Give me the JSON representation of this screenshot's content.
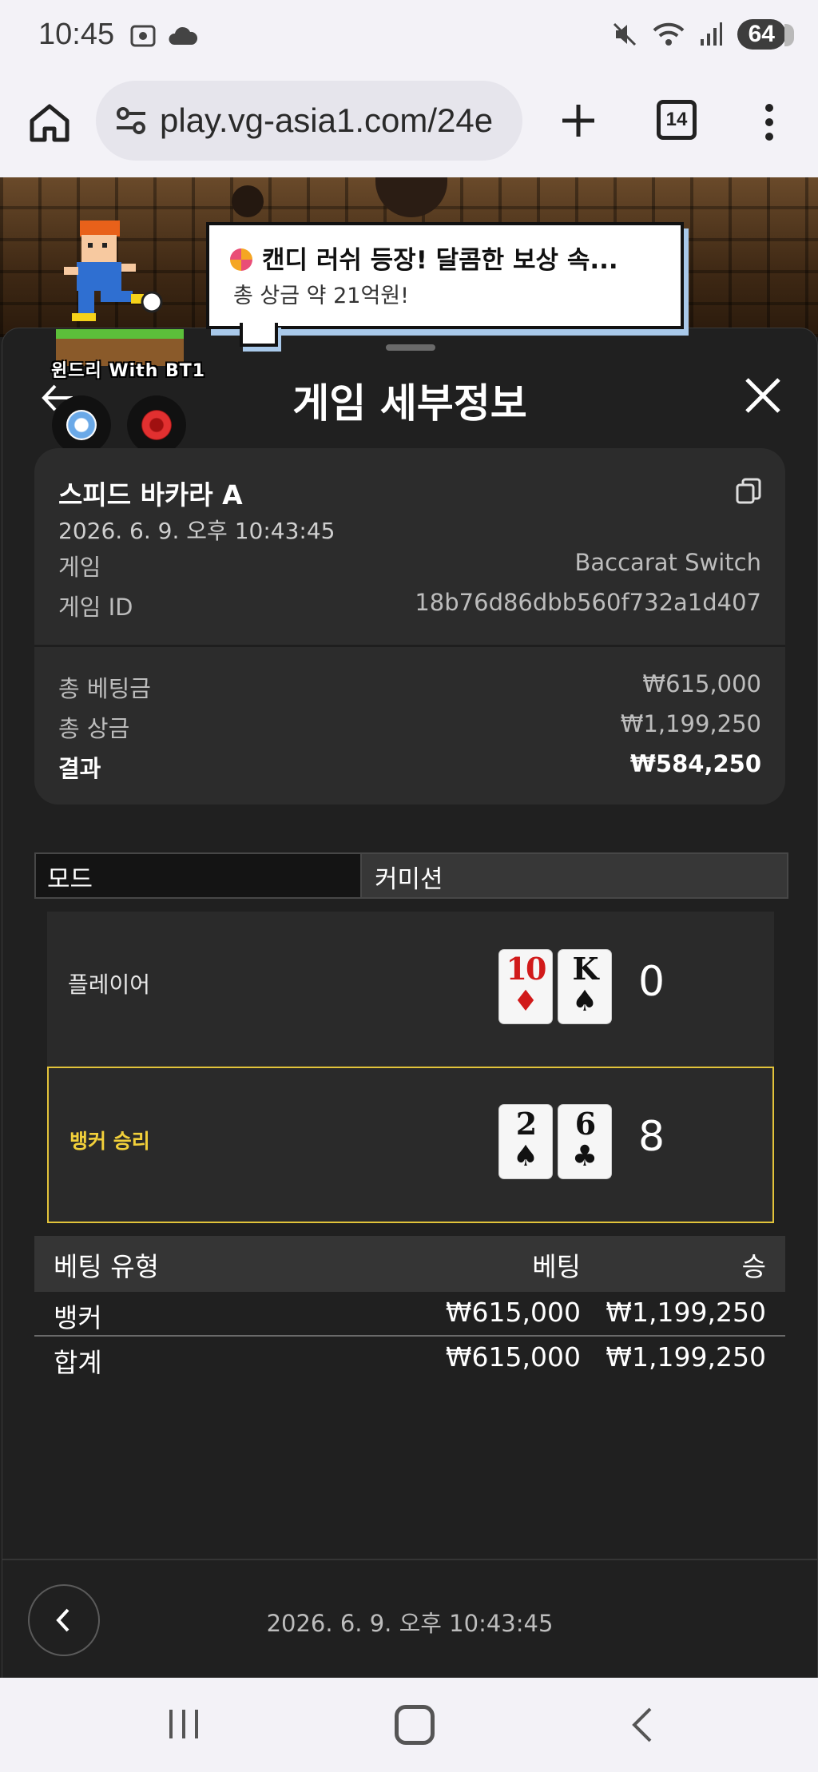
{
  "status_bar": {
    "time": "10:45",
    "battery": "64",
    "icons": [
      "screenshot-icon",
      "cloud-icon",
      "mute-icon",
      "wifi-icon",
      "signal-icon"
    ]
  },
  "browser": {
    "url": "play.vg-asia1.com/24e",
    "tab_count": "14"
  },
  "promo": {
    "title": "캔디 러쉬 등장! 달콤한 보상 속...",
    "subtitle": "총 상금 약 21억원!",
    "mascot_tag": "윈드리 With BT1"
  },
  "sheet": {
    "title": "게임 세부정보"
  },
  "summary": {
    "game_name": "스피드 바카라 A",
    "date": "2026. 6. 9. 오후 10:43:45",
    "rows": [
      {
        "label": "게임",
        "value": "Baccarat Switch"
      },
      {
        "label": "게임 ID",
        "value": "18b76d86dbb560f732a1d407"
      }
    ],
    "totals": [
      {
        "label": "총 베팅금",
        "value": "₩615,000"
      },
      {
        "label": "총 상금",
        "value": "₩1,199,250"
      },
      {
        "label": "결과",
        "value": "₩584,250"
      }
    ]
  },
  "mode": {
    "label": "모드",
    "value": "커미션"
  },
  "hands": {
    "player": {
      "label": "플레이어",
      "score": "0",
      "cards": [
        {
          "rank": "10",
          "suit": "♦",
          "color": "#d11a1a"
        },
        {
          "rank": "K",
          "suit": "♠",
          "color": "#111111"
        }
      ]
    },
    "banker": {
      "label": "뱅커 승리",
      "score": "8",
      "cards": [
        {
          "rank": "2",
          "suit": "♠",
          "color": "#111111"
        },
        {
          "rank": "6",
          "suit": "♣",
          "color": "#111111"
        }
      ]
    }
  },
  "bets": {
    "headers": [
      "베팅 유형",
      "베팅",
      "승"
    ],
    "rows": [
      {
        "type": "뱅커",
        "bet": "₩615,000",
        "win": "₩1,199,250"
      }
    ],
    "total": {
      "type": "합계",
      "bet": "₩615,000",
      "win": "₩1,199,250"
    }
  },
  "footer": {
    "date": "2026. 6. 9. 오후 10:43:45"
  },
  "colors": {
    "winner_highlight": "#e2c33a",
    "background": "#202020"
  }
}
